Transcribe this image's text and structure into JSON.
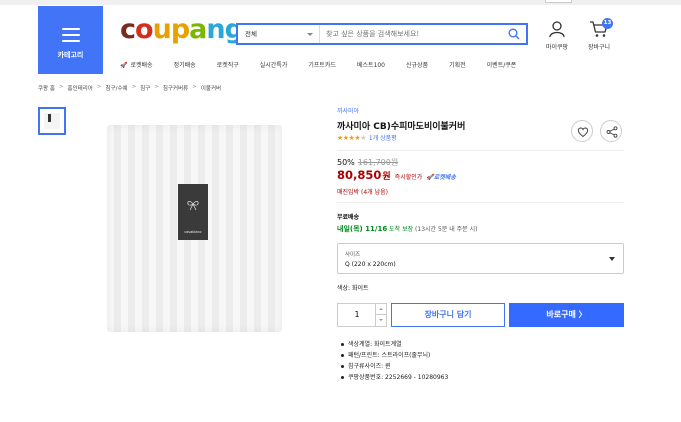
{
  "header": {
    "category_label": "카테고리",
    "logo_parts": [
      "c",
      "o",
      "u",
      "p",
      "a",
      "n",
      "g"
    ],
    "search": {
      "category": "전체",
      "placeholder": "찾고 싶은 상품을 검색해보세요!"
    },
    "mycoupang_label": "마이쿠팡",
    "cart_label": "장바구니",
    "cart_count": "13"
  },
  "nav": [
    {
      "label": "로켓배송",
      "rocket": true
    },
    {
      "label": "정기배송"
    },
    {
      "label": "로켓직구"
    },
    {
      "label": "실시간특가"
    },
    {
      "label": "기프트카드"
    },
    {
      "label": "베스트100"
    },
    {
      "label": "신규상품"
    },
    {
      "label": "기획전"
    },
    {
      "label": "이벤트/쿠폰"
    }
  ],
  "breadcrumb": [
    "쿠팡 홈",
    "홈인테리어",
    "침구/수예",
    "침구",
    "침구커버류",
    "이불커버"
  ],
  "product": {
    "brand": "까사미아",
    "title": "까사미아 CB)수피마도비이불커버",
    "rating_stars": 4,
    "review_count": "1개 상품평",
    "discount_rate": "50%",
    "original_price": "161,700원",
    "price": "80,850",
    "price_unit": "원",
    "instant_discount": "즉시할인가",
    "rocket_delivery": "로켓배송",
    "stock_note": "매진임박 (4개 남음)",
    "shipping_free": "무료배송",
    "shipping_date": "내일(목) 11/16",
    "shipping_guarantee": "도착 보장",
    "shipping_deadline": "(13시간 5분 내 주문 시)",
    "option_key": "사이즈",
    "option_value": "Q (220 x 220cm)",
    "color_line": "색상: 화이트",
    "quantity": "1",
    "add_to_cart": "장바구니 담기",
    "buy_now": "바로구매 〉",
    "image_label_text": "casablanc",
    "specs": [
      "색상계열: 화이트계열",
      "패턴/프린트: 스트라이프(줄무늬)",
      "침구류사이즈: 퀸",
      "쿠팡상품번호: 2252669 - 10280963"
    ]
  },
  "colors": {
    "accent": "#4174f6",
    "price": "#ae0000",
    "delivery": "#00891a"
  }
}
